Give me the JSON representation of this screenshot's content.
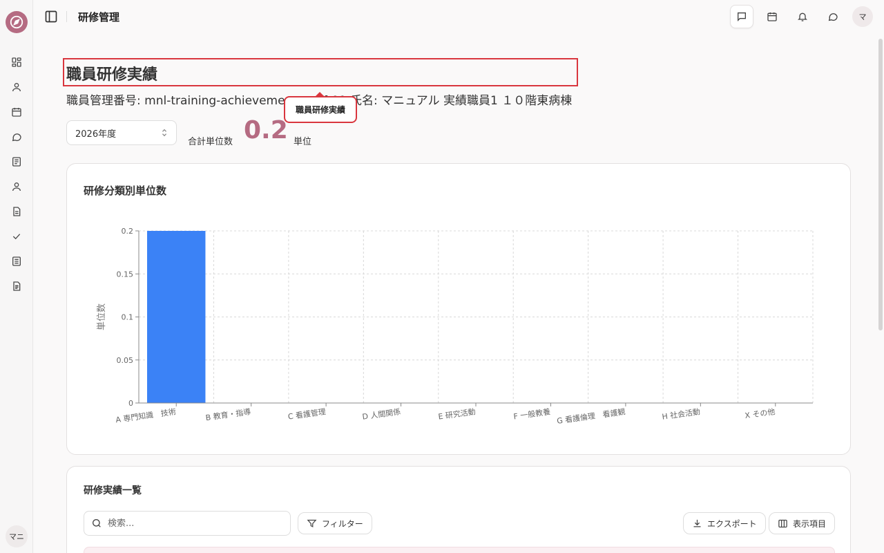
{
  "sidebar": {
    "logo_icon": "compass-icon",
    "items": [
      {
        "icon": "dashboard-icon"
      },
      {
        "icon": "user-icon"
      },
      {
        "icon": "calendar-icon"
      },
      {
        "icon": "message-icon"
      },
      {
        "icon": "book-icon"
      },
      {
        "icon": "person-icon"
      },
      {
        "icon": "file-icon"
      },
      {
        "icon": "check-icon"
      },
      {
        "icon": "notebook-icon"
      },
      {
        "icon": "document-icon"
      }
    ],
    "user_initials": "マニ"
  },
  "header": {
    "title": "研修管理",
    "user_initial": "マ",
    "buttons": [
      "chat-square-icon",
      "calendar-icon",
      "bell-icon",
      "message-circle-icon"
    ]
  },
  "page": {
    "title": "職員研修実績",
    "subtitle": "職員管理番号: mnl-training-achievement-staff-01 氏名: マニュアル 実績職員1 １０階東病棟",
    "tooltip": "職員研修実績",
    "year_selected": "2026年度",
    "total_label": "合計単位数",
    "total_value": "0.2",
    "unit_label": "単位"
  },
  "chart_section": {
    "title": "研修分類別単位数"
  },
  "chart_data": {
    "type": "bar",
    "title": "研修分類別単位数",
    "xlabel": "",
    "ylabel": "単位数",
    "ylim": [
      0,
      0.2
    ],
    "yticks": [
      "0",
      "0.05",
      "0.1",
      "0.15",
      "0.2"
    ],
    "grid": true,
    "color": "#3b82f6",
    "categories": [
      "A 専門知識　技術",
      "B 教育・指導",
      "C 看護管理",
      "D 人間関係",
      "E 研究活動",
      "F 一般教養",
      "G 看護倫理　看護観",
      "H 社会活動",
      "X その他"
    ],
    "values": [
      0.2,
      0,
      0,
      0,
      0,
      0,
      0,
      0,
      0
    ]
  },
  "list_section": {
    "title": "研修実績一覧",
    "search_placeholder": "検索...",
    "filter_label": "フィルター",
    "export_label": "エクスポート",
    "columns_label": "表示項目"
  }
}
